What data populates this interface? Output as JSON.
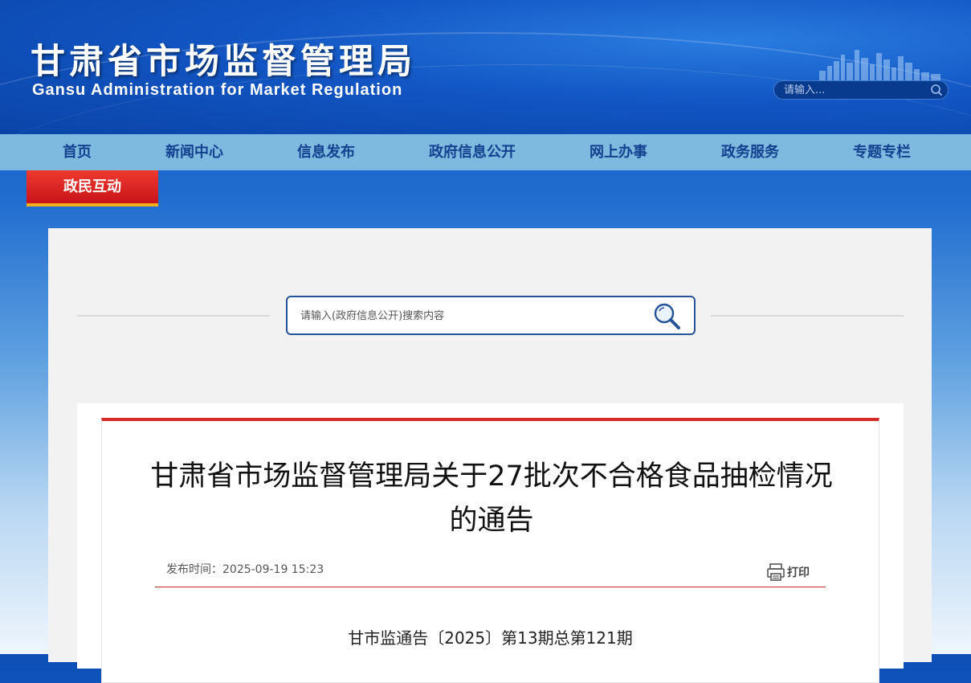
{
  "header": {
    "title_cn": "甘肃省市场监督管理局",
    "title_en": "Gansu Administration for Market Regulation",
    "search_placeholder": "请输入..."
  },
  "nav": {
    "items": [
      "首页",
      "新闻中心",
      "信息发布",
      "政府信息公开",
      "网上办事",
      "政务服务",
      "专题专栏"
    ],
    "active_item": "政民互动"
  },
  "search": {
    "placeholder": "请输入(政府信息公开)搜索内容"
  },
  "article": {
    "title": "甘肃省市场监督管理局关于27批次不合格食品抽检情况的通告",
    "publish_label": "发布时间：",
    "publish_time": "2025-09-19 15:23",
    "print_label": "打印",
    "doc_number": "甘市监通告〔2025〕第13期总第121期"
  },
  "colors": {
    "nav_bg": "#7eb9e0",
    "nav_text": "#12428f",
    "active_red": "#d0191e",
    "accent_gold": "#f0b21a",
    "article_rule": "#d42a28"
  }
}
